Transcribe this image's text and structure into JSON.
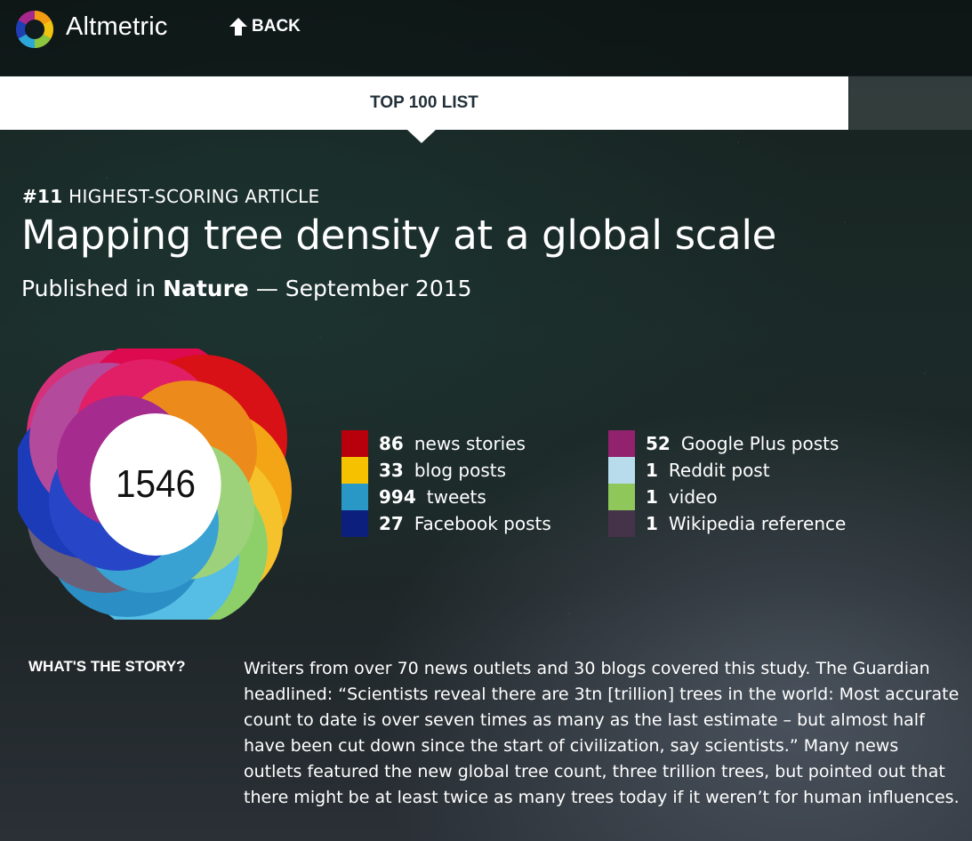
{
  "header": {
    "brand": "Altmetric",
    "back_label": "BACK"
  },
  "tabbar": {
    "label": "TOP 100 LIST"
  },
  "article": {
    "rank": "#11",
    "rank_suffix": "HIGHEST-SCORING ARTICLE",
    "title": "Mapping tree density at a global scale",
    "published_prefix": "Published in",
    "journal": "Nature",
    "published_suffix": "— September 2015",
    "score": "1546"
  },
  "mentions": {
    "left": [
      {
        "count": "86",
        "label": "news stories",
        "color": "#b8000d"
      },
      {
        "count": "33",
        "label": "blog posts",
        "color": "#f6c200"
      },
      {
        "count": "994",
        "label": "tweets",
        "color": "#2a98c6"
      },
      {
        "count": "27",
        "label": "Facebook posts",
        "color": "#0c1f7c"
      }
    ],
    "right": [
      {
        "count": "52",
        "label": "Google Plus posts",
        "color": "#92226e"
      },
      {
        "count": "1",
        "label": "Reddit post",
        "color": "#b9dcec"
      },
      {
        "count": "1",
        "label": "video",
        "color": "#8fc75b"
      },
      {
        "count": "1",
        "label": "Wikipedia reference",
        "color": "#443349"
      }
    ]
  },
  "story": {
    "label": "WHAT'S THE STORY?",
    "text": "Writers from over 70 news outlets and 30 blogs covered this study. The Guardian headlined: “Scientists reveal there are 3tn [trillion] trees in the world: Most accurate count to date is over seven times as many as the last estimate – but almost half have been cut down since the start of civilization, say scientists.” Many news outlets featured the new global tree count, three trillion trees, but pointed out that there might be at least twice as many trees today if it weren’t for human influences."
  },
  "icons": {
    "logo": "altmetric-donut-logo",
    "back": "arrow-up-icon"
  },
  "colors": {
    "tab_text": "#22303a"
  }
}
